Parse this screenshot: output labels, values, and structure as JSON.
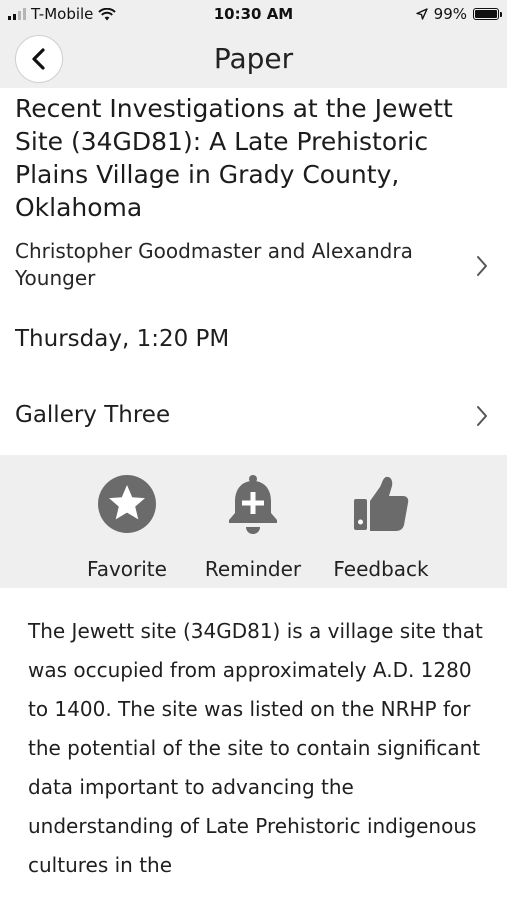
{
  "status_bar": {
    "carrier": "T-Mobile",
    "time": "10:30 AM",
    "battery": "99%",
    "battery_level": 0.99,
    "signal_bars": 2
  },
  "nav": {
    "title": "Paper"
  },
  "paper": {
    "title": "Recent Investigations at the Jewett Site (34GD81): A Late Prehistoric Plains Village in Grady County, Oklahoma",
    "authors": "Christopher Goodmaster and Alexandra Younger",
    "time": "Thursday, 1:20 PM",
    "location": "Gallery Three"
  },
  "actions": {
    "favorite": {
      "label": "Favorite",
      "icon": "star-icon"
    },
    "reminder": {
      "label": "Reminder",
      "icon": "bell-plus-icon"
    },
    "feedback": {
      "label": "Feedback",
      "icon": "thumbs-up-icon"
    }
  },
  "description": "The Jewett site (34GD81) is a village site that was occupied from approximately A.D. 1280 to 1400. The site was listed on the NRHP for the potential of the site to contain significant data important to advancing the understanding of Late Prehistoric indigenous cultures in the",
  "colors": {
    "bar_background": "#efefef",
    "icon_gray": "#6b6b6b",
    "text": "#1a1a1a"
  }
}
